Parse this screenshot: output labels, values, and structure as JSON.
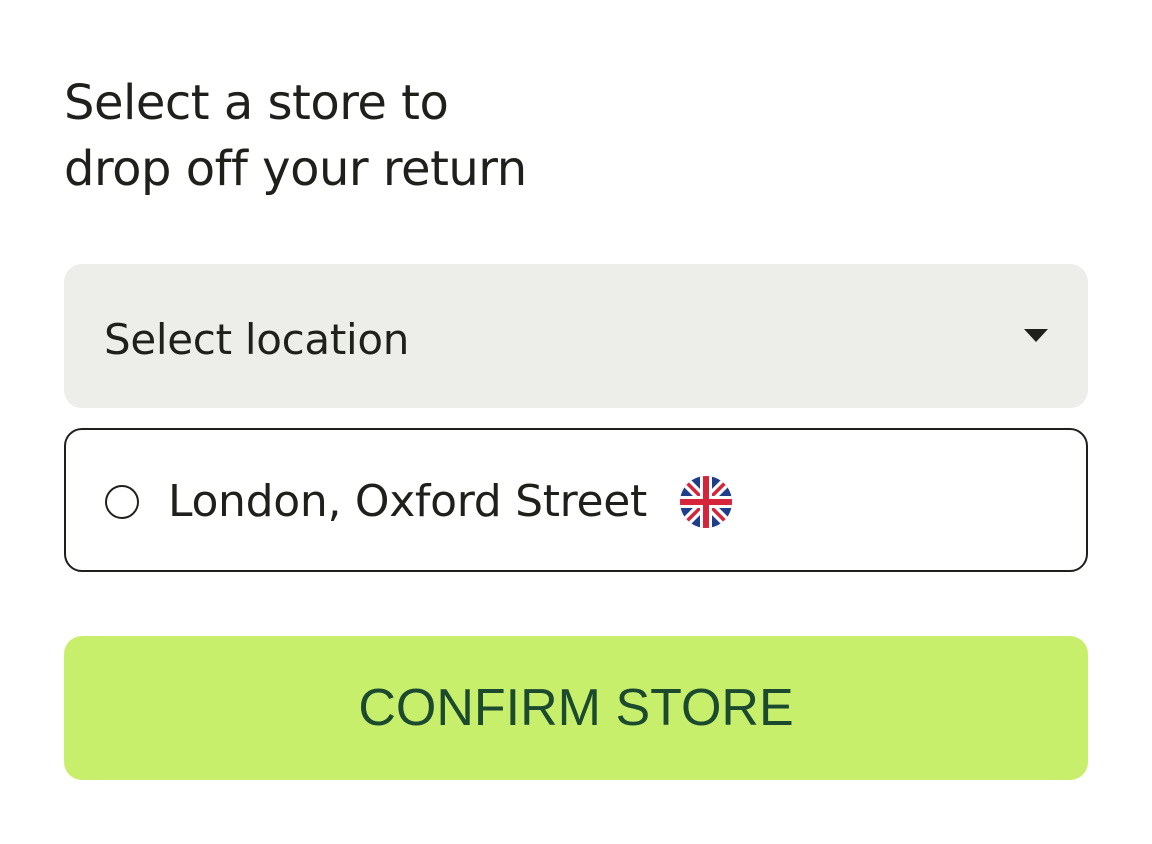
{
  "heading": {
    "line1": "Select a store to",
    "line2": "drop off your return"
  },
  "location_select": {
    "label": "Select location",
    "icon": "caret-down-icon"
  },
  "store_options": [
    {
      "name": "London, Oxford Street",
      "selected": false,
      "flag_icon": "uk-flag-icon"
    }
  ],
  "confirm_button": {
    "label": "CONFIRM STORE"
  },
  "colors": {
    "text": "#1f1f1c",
    "select_background": "#edeee9",
    "button_background": "#c8ef6c",
    "button_text": "#1b4a2e",
    "flag_blue": "#1e3e8c",
    "flag_red": "#d6253b"
  }
}
